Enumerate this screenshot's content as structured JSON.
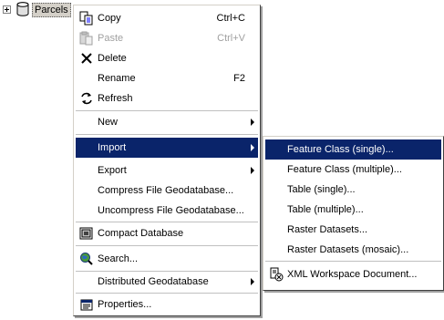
{
  "tree": {
    "node_label": "Parcels"
  },
  "context_menu": {
    "items": [
      {
        "label": "Copy",
        "shortcut": "Ctrl+C"
      },
      {
        "label": "Paste",
        "shortcut": "Ctrl+V"
      },
      {
        "label": "Delete"
      },
      {
        "label": "Rename",
        "shortcut": "F2"
      },
      {
        "label": "Refresh"
      },
      {
        "label": "New"
      },
      {
        "label": "Import"
      },
      {
        "label": "Export"
      },
      {
        "label": "Compress File Geodatabase..."
      },
      {
        "label": "Uncompress File Geodatabase..."
      },
      {
        "label": "Compact Database"
      },
      {
        "label": "Search..."
      },
      {
        "label": "Distributed Geodatabase"
      },
      {
        "label": "Properties..."
      }
    ]
  },
  "import_submenu": {
    "items": [
      {
        "label": "Feature Class (single)..."
      },
      {
        "label": "Feature Class (multiple)..."
      },
      {
        "label": "Table (single)..."
      },
      {
        "label": "Table (multiple)..."
      },
      {
        "label": "Raster Datasets..."
      },
      {
        "label": "Raster Datasets (mosaic)..."
      },
      {
        "label": "XML Workspace Document..."
      }
    ]
  },
  "colors": {
    "highlight": "#0a246a",
    "menu_bg": "#ffffff",
    "disabled_text": "#a0a0a0"
  }
}
